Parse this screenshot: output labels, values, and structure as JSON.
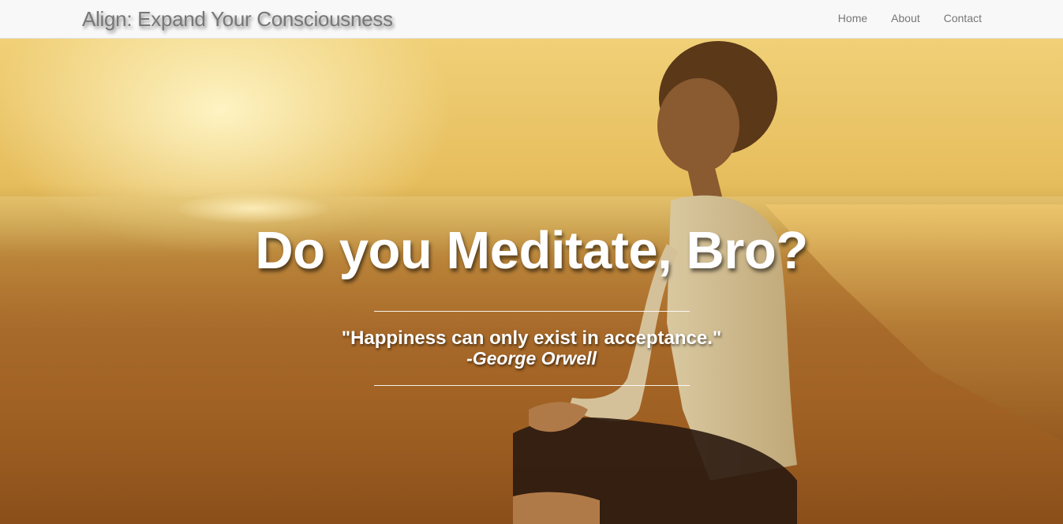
{
  "nav": {
    "brand": "Align: Expand Your Consciousness",
    "links": [
      "Home",
      "About",
      "Contact"
    ]
  },
  "hero": {
    "headline": "Do you Meditate, Bro?",
    "quote": "\"Happiness can only exist in acceptance.\"",
    "author": "-George Orwell"
  },
  "colors": {
    "navbar_bg": "#f8f8f8",
    "nav_text": "#777777",
    "hero_text": "#ffffff"
  }
}
